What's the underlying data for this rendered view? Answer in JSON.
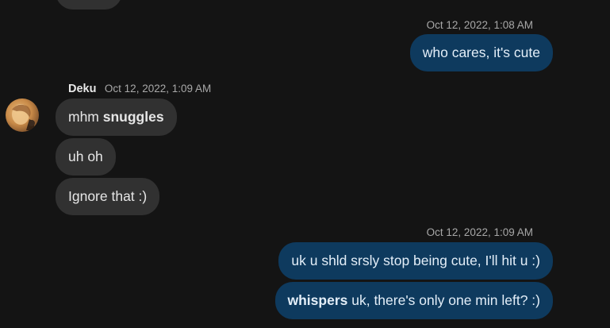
{
  "conversation": {
    "messages": [
      {
        "text": ""
      },
      {
        "timestamp": "Oct 12, 2022, 1:08 AM",
        "text": "who cares, it's cute"
      },
      {
        "sender": "Deku",
        "timestamp": "Oct 12, 2022, 1:09 AM",
        "prefix": "mhm ",
        "bold": "snuggles"
      },
      {
        "text": "uh oh"
      },
      {
        "text": "Ignore that :)"
      },
      {
        "timestamp": "Oct 12, 2022, 1:09 AM",
        "text": "uk u shld srsly stop being cute, I'll hit u :)"
      },
      {
        "bold": "whispers",
        "suffix": " uk, there's only one min left? :)"
      }
    ]
  },
  "colors": {
    "background": "#141414",
    "incoming_bubble": "#313131",
    "outgoing_bubble": "#0e3a5e"
  }
}
